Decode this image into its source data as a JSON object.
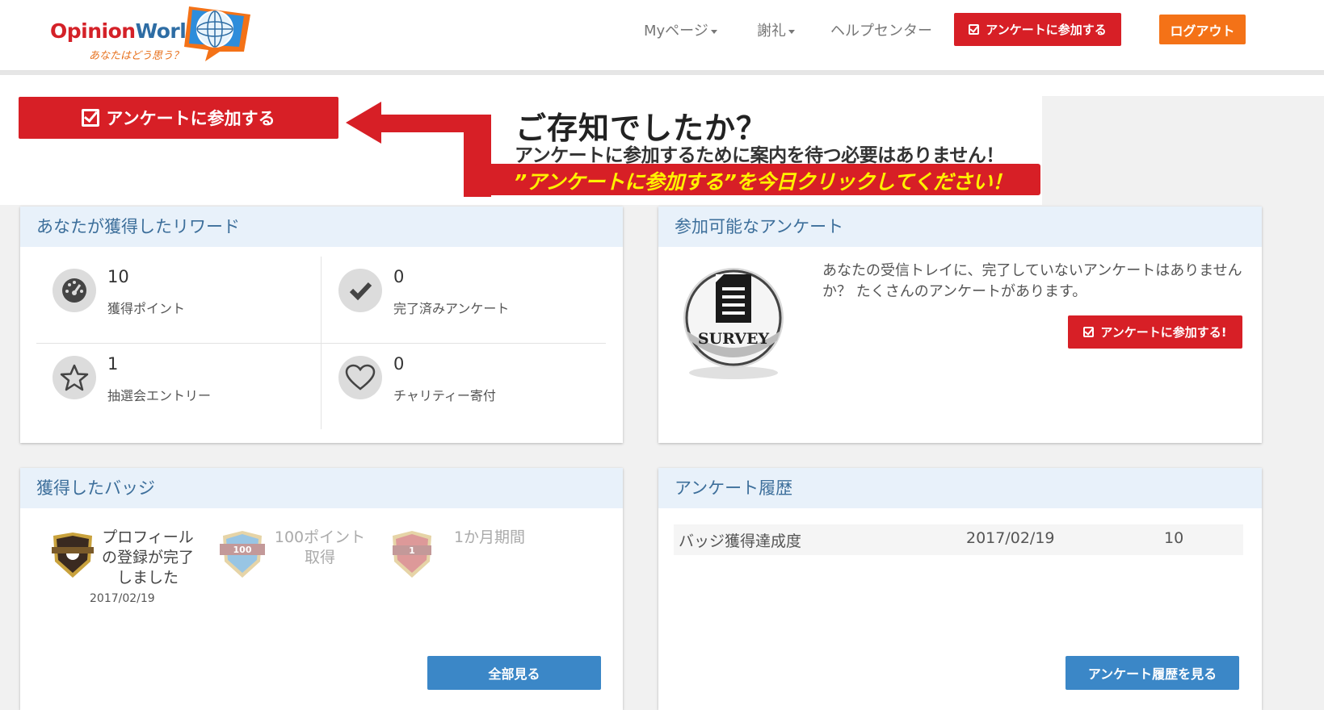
{
  "header": {
    "logo_opinion": "Opinion",
    "logo_world": "World",
    "logo_tagline": "あなたはどう思う？",
    "nav": [
      {
        "label": "Myページ"
      },
      {
        "label": "謝礼"
      },
      {
        "label": "ヘルプセンター"
      }
    ],
    "take_survey_label": "アンケートに参加する",
    "logout_label": "ログアウト"
  },
  "banner": {
    "button_label": "アンケートに参加する",
    "heading": "ご存知でしたか？",
    "text": "アンケートに参加するために案内を待つ必要はありません！",
    "highlight": "”アンケートに参加する”を今日クリックしてください！"
  },
  "rewards": {
    "title": "あなたが獲得したリワード",
    "stats": [
      {
        "value": "10",
        "label": "獲得ポイント",
        "icon": "gauge-icon"
      },
      {
        "value": "0",
        "label": "完了済みアンケート",
        "icon": "checkmark-icon"
      },
      {
        "value": "1",
        "label": "抽選会エントリー",
        "icon": "star-icon"
      },
      {
        "value": "0",
        "label": "チャリティー寄付",
        "icon": "heart-icon"
      }
    ]
  },
  "available": {
    "title": "参加可能なアンケート",
    "image_label": "SURVEY",
    "text": "あなたの受信トレイに、完了していないアンケートはありませんか？ たくさんのアンケートがあります。",
    "button_label": "アンケートに参加する!"
  },
  "badges": {
    "title": "獲得したバッジ",
    "items": [
      {
        "label": "プロフィールの登録が完了しました",
        "date": "2017/02/19",
        "badge_text": ""
      },
      {
        "label": "100ポイント取得",
        "date": "",
        "badge_text": "100"
      },
      {
        "label": "1か月期間",
        "date": "",
        "badge_text": "1"
      }
    ],
    "button_label": "全部見る"
  },
  "history": {
    "title": "アンケート履歴",
    "rows": [
      {
        "name": "バッジ獲得達成度",
        "date": "2017/02/19",
        "points": "10"
      }
    ],
    "button_label": "アンケート履歴を見る"
  },
  "colors": {
    "red": "#d71f26",
    "orange": "#f47217",
    "blue": "#3b87c7",
    "panel_header_bg": "#e8f1fa",
    "panel_header_text": "#3d6f9b"
  }
}
